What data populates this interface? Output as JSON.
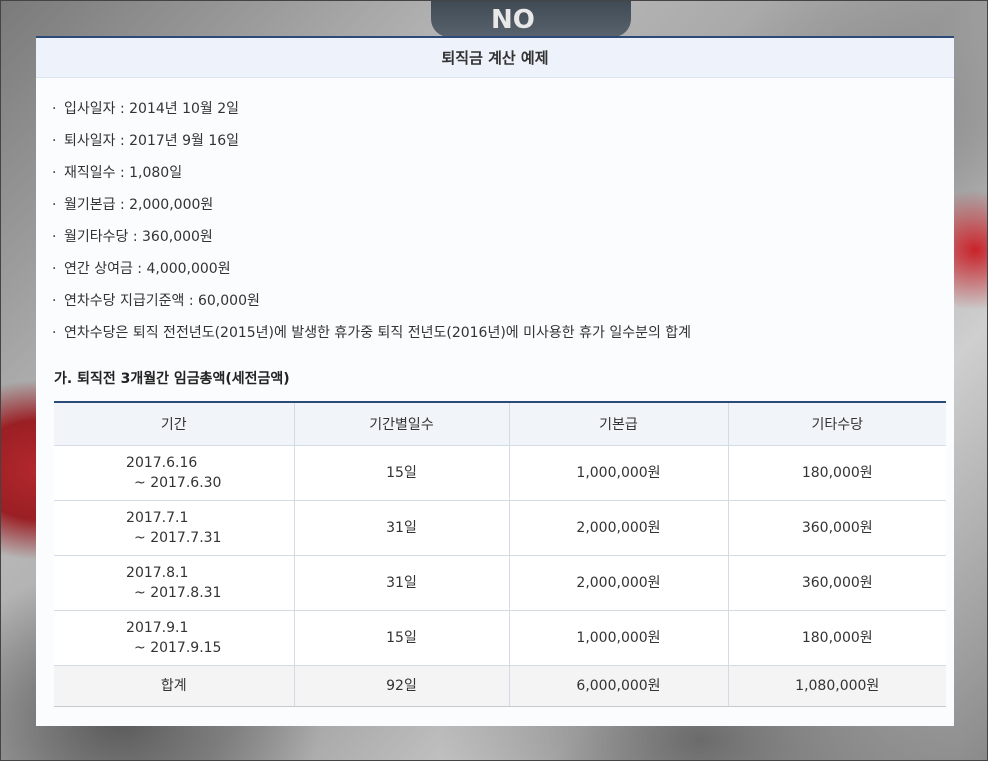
{
  "title": "퇴직금 계산 예제",
  "info": [
    "입사일자 : 2014년 10월 2일",
    "퇴사일자 : 2017년 9월 16일",
    "재직일수 : 1,080일",
    "월기본급 : 2,000,000원",
    "월기타수당 : 360,000원",
    "연간 상여금 : 4,000,000원",
    "연차수당 지급기준액 : 60,000원",
    "연차수당은 퇴직 전전년도(2015년)에 발생한 휴가중 퇴직 전년도(2016년)에 미사용한 휴가 일수분의 합계"
  ],
  "bullet": "·",
  "section": {
    "title": "가. 퇴직전 3개월간 임금총액(세전금액)"
  },
  "table": {
    "headers": [
      "기간",
      "기간별일수",
      "기본급",
      "기타수당"
    ],
    "rows": [
      {
        "start": "2017.6.16",
        "end": "~ 2017.6.30",
        "days": "15일",
        "base": "1,000,000원",
        "other": "180,000원"
      },
      {
        "start": "2017.7.1",
        "end": "~ 2017.7.31",
        "days": "31일",
        "base": "2,000,000원",
        "other": "360,000원"
      },
      {
        "start": "2017.8.1",
        "end": "~ 2017.8.31",
        "days": "31일",
        "base": "2,000,000원",
        "other": "360,000원"
      },
      {
        "start": "2017.9.1",
        "end": "~ 2017.9.15",
        "days": "15일",
        "base": "1,000,000원",
        "other": "180,000원"
      }
    ],
    "total": {
      "label": "합계",
      "days": "92일",
      "base": "6,000,000원",
      "other": "1,080,000원"
    }
  },
  "background_key_text": "NO"
}
